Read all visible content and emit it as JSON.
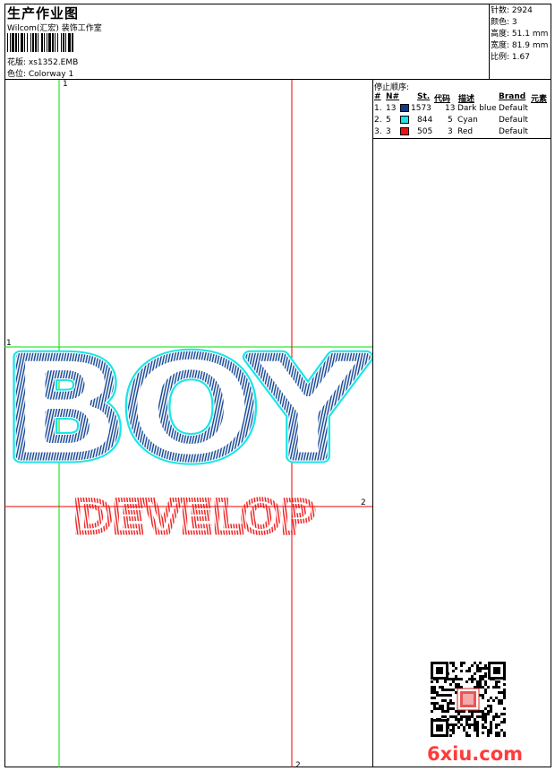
{
  "header": {
    "title": "生产作业图",
    "company": "Wilcom(汇宏) 装饰工作室",
    "design_name": "花版: xs1352.EMB",
    "colorway": "色位: Colorway 1"
  },
  "stats": [
    {
      "label": "针数:",
      "value": "2924"
    },
    {
      "label": "颜色:",
      "value": "3"
    },
    {
      "label": "高度:",
      "value": "51.1 mm"
    },
    {
      "label": "宽度:",
      "value": "81.9 mm"
    },
    {
      "label": "比例:",
      "value": "1.67"
    }
  ],
  "stop_sequence": {
    "title": "停止顺序:",
    "columns": [
      "#",
      "N#",
      "St.",
      "代码",
      "描述",
      "Brand",
      "元素"
    ],
    "rows": [
      {
        "index": "1.",
        "needle": "13",
        "color": "#0a3d8f",
        "stitches": "1573",
        "code": "13",
        "description": "Dark blue",
        "brand": "Default"
      },
      {
        "index": "2.",
        "needle": "5",
        "color": "#19e6e6",
        "stitches": "844",
        "code": "5",
        "description": "Cyan",
        "brand": "Default"
      },
      {
        "index": "3.",
        "needle": "3",
        "color": "#ee1111",
        "stitches": "505",
        "code": "3",
        "description": "Red",
        "brand": "Default"
      }
    ]
  },
  "design": {
    "main_text": "BOY",
    "sub_text": "DEVELOP",
    "colors": {
      "outline": "#19e6e6",
      "main": "#0a3d8f",
      "sub": "#ee1111"
    }
  },
  "guides": {
    "green_labels": [
      "1",
      "1"
    ],
    "red_labels": [
      "2",
      "2"
    ],
    "colors": {
      "green": "#00dd00",
      "red": "#ee0000"
    }
  },
  "watermark": {
    "logo_text": "6xiu.com",
    "qr_icon": "qr-code-icon"
  }
}
